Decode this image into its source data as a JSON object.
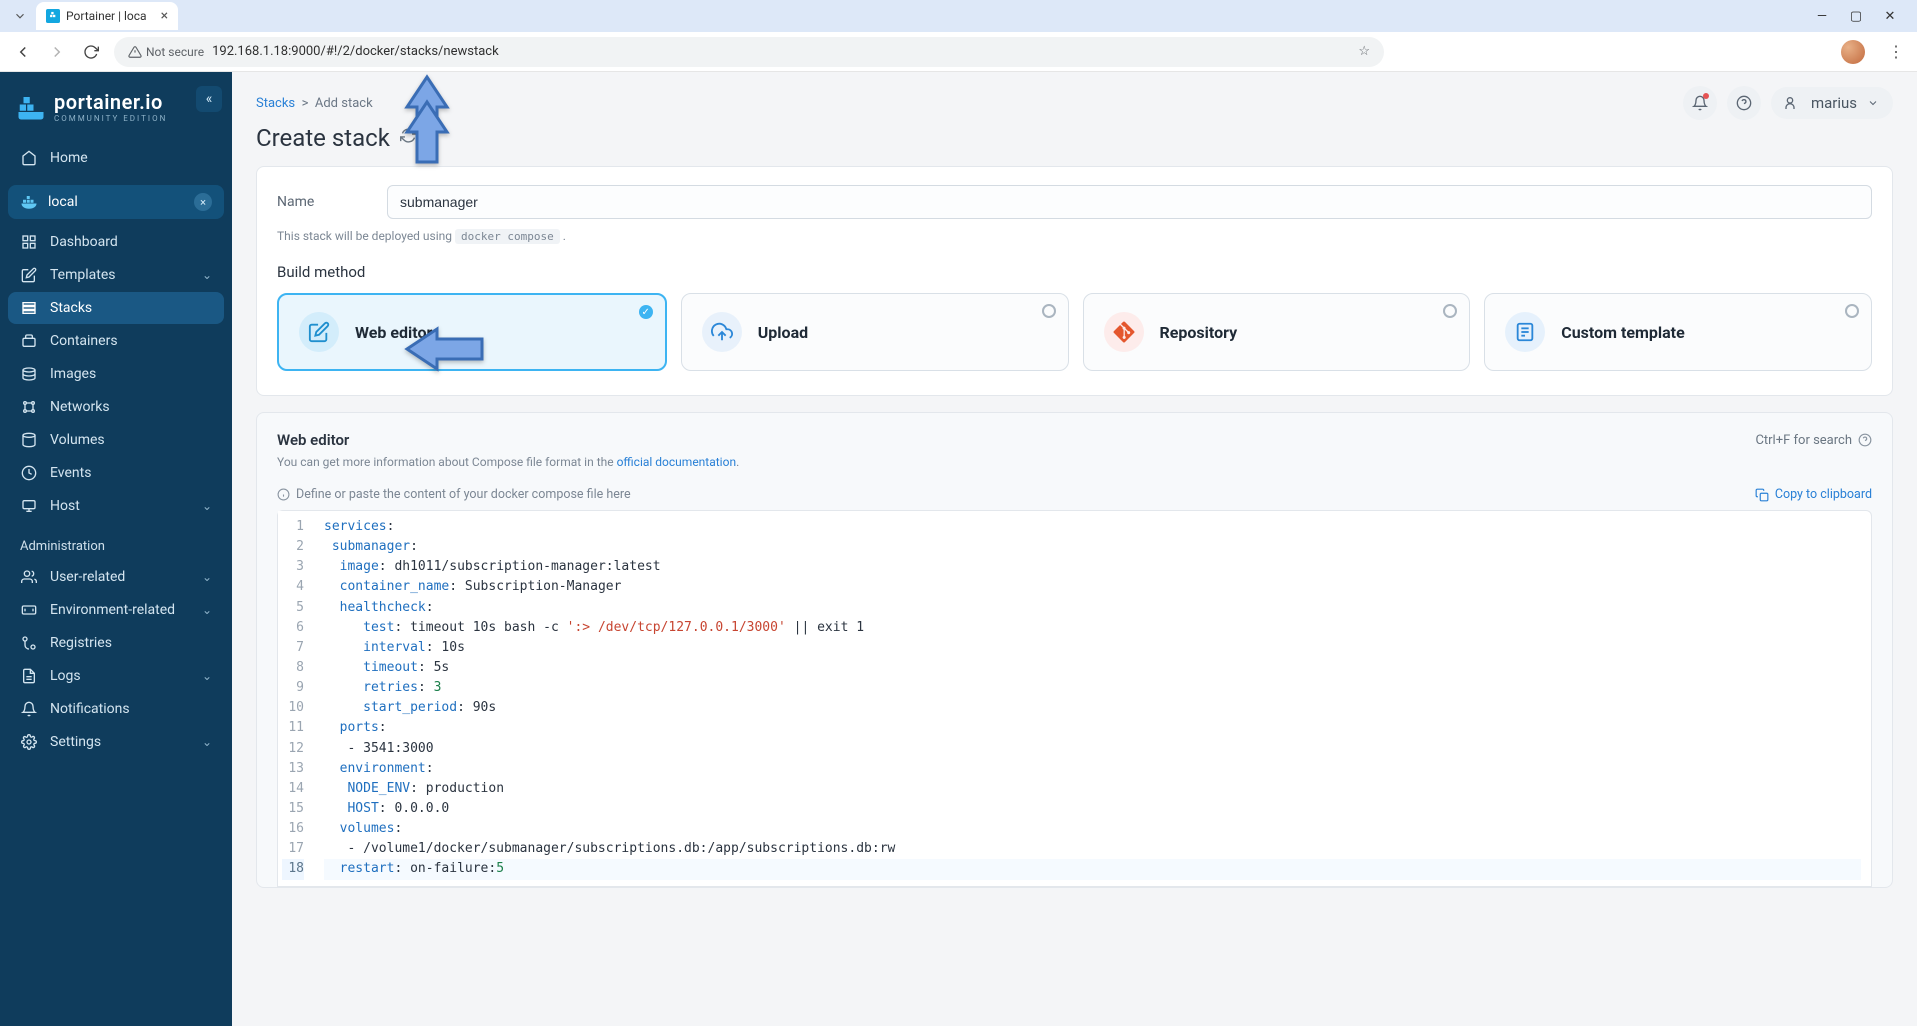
{
  "browser": {
    "tab_title": "Portainer | loca",
    "url": "192.168.1.18:9000/#!/2/docker/stacks/newstack",
    "not_secure_label": "Not secure"
  },
  "sidebar": {
    "brand": "portainer.io",
    "brand_sub": "COMMUNITY EDITION",
    "home": "Home",
    "env_label": "local",
    "items": [
      {
        "label": "Dashboard"
      },
      {
        "label": "Templates",
        "chev": true
      },
      {
        "label": "Stacks",
        "active": true
      },
      {
        "label": "Containers"
      },
      {
        "label": "Images"
      },
      {
        "label": "Networks"
      },
      {
        "label": "Volumes"
      },
      {
        "label": "Events"
      },
      {
        "label": "Host",
        "chev": true
      }
    ],
    "admin_label": "Administration",
    "admin_items": [
      {
        "label": "User-related",
        "chev": true
      },
      {
        "label": "Environment-related",
        "chev": true
      },
      {
        "label": "Registries"
      },
      {
        "label": "Logs",
        "chev": true
      },
      {
        "label": "Notifications"
      },
      {
        "label": "Settings",
        "chev": true
      }
    ]
  },
  "header": {
    "breadcrumb_root": "Stacks",
    "breadcrumb_sep": ">",
    "breadcrumb_leaf": "Add stack",
    "page_title": "Create stack",
    "username": "marius"
  },
  "form": {
    "name_label": "Name",
    "name_value": "submanager",
    "deploy_hint_pre": "This stack will be deployed using ",
    "deploy_hint_code": "docker compose",
    "deploy_hint_post": " .",
    "build_method_label": "Build method",
    "methods": {
      "web": "Web editor",
      "upload": "Upload",
      "repo": "Repository",
      "tmpl": "Custom template"
    }
  },
  "editor": {
    "title": "Web editor",
    "search_hint": "Ctrl+F for search",
    "sub_pre": "You can get more information about Compose file format in the ",
    "sub_link": "official documentation",
    "sub_post": ".",
    "placeholder_info": "Define or paste the content of your docker compose file here",
    "copy_label": "Copy to clipboard",
    "lines": [
      [
        [
          "key",
          "services"
        ],
        [
          "plain",
          ":"
        ]
      ],
      [
        [
          "plain",
          " "
        ],
        [
          "key",
          "submanager"
        ],
        [
          "plain",
          ":"
        ]
      ],
      [
        [
          "plain",
          "  "
        ],
        [
          "key",
          "image"
        ],
        [
          "plain",
          ": dh1011/subscription-manager:latest"
        ]
      ],
      [
        [
          "plain",
          "  "
        ],
        [
          "key",
          "container_name"
        ],
        [
          "plain",
          ": Subscription-Manager"
        ]
      ],
      [
        [
          "plain",
          "  "
        ],
        [
          "key",
          "healthcheck"
        ],
        [
          "plain",
          ":"
        ]
      ],
      [
        [
          "plain",
          "     "
        ],
        [
          "key",
          "test"
        ],
        [
          "plain",
          ": timeout 10s bash -c "
        ],
        [
          "str",
          "':> /dev/tcp/127.0.0.1/3000'"
        ],
        [
          "plain",
          " || exit 1"
        ]
      ],
      [
        [
          "plain",
          "     "
        ],
        [
          "key",
          "interval"
        ],
        [
          "plain",
          ": 10s"
        ]
      ],
      [
        [
          "plain",
          "     "
        ],
        [
          "key",
          "timeout"
        ],
        [
          "plain",
          ": 5s"
        ]
      ],
      [
        [
          "plain",
          "     "
        ],
        [
          "key",
          "retries"
        ],
        [
          "plain",
          ": "
        ],
        [
          "num",
          "3"
        ]
      ],
      [
        [
          "plain",
          "     "
        ],
        [
          "key",
          "start_period"
        ],
        [
          "plain",
          ": 90s"
        ]
      ],
      [
        [
          "plain",
          "  "
        ],
        [
          "key",
          "ports"
        ],
        [
          "plain",
          ":"
        ]
      ],
      [
        [
          "plain",
          "   - 3541:3000"
        ]
      ],
      [
        [
          "plain",
          "  "
        ],
        [
          "key",
          "environment"
        ],
        [
          "plain",
          ":"
        ]
      ],
      [
        [
          "plain",
          "   "
        ],
        [
          "key",
          "NODE_ENV"
        ],
        [
          "plain",
          ": production"
        ]
      ],
      [
        [
          "plain",
          "   "
        ],
        [
          "key",
          "HOST"
        ],
        [
          "plain",
          ": 0.0.0.0"
        ]
      ],
      [
        [
          "plain",
          "  "
        ],
        [
          "key",
          "volumes"
        ],
        [
          "plain",
          ":"
        ]
      ],
      [
        [
          "plain",
          "   - /volume1/docker/submanager/subscriptions.db:/app/subscriptions.db:rw"
        ]
      ],
      [
        [
          "plain",
          "  "
        ],
        [
          "key",
          "restart"
        ],
        [
          "plain",
          ": on-failure:"
        ],
        [
          "num",
          "5"
        ]
      ]
    ],
    "current_line_index": 17
  }
}
